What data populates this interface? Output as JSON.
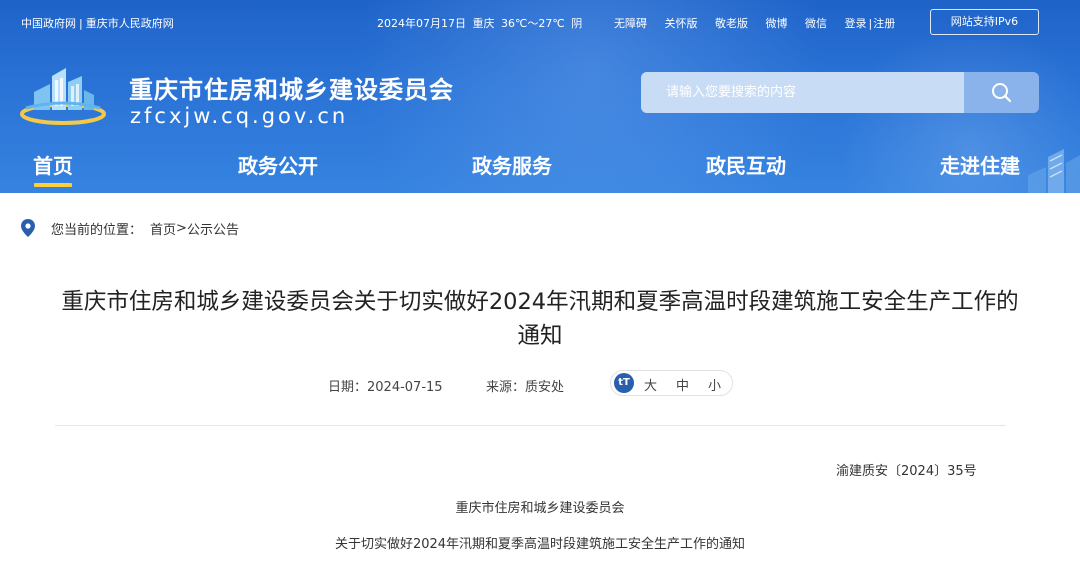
{
  "topbar": {
    "gov_links": [
      "中国政府网",
      "重庆市人民政府网"
    ],
    "separator": "|",
    "date": "2024年07月17日",
    "city": "重庆",
    "temperature": "36℃～27℃",
    "weather": "阴",
    "links": [
      "无障碍",
      "关怀版",
      "敬老版",
      "微博",
      "微信",
      "登录"
    ],
    "register": "注册",
    "ipv6": "网站支持IPv6"
  },
  "brand": {
    "title": "重庆市住房和城乡建设委员会",
    "domain": "zfcxjw.cq.gov.cn",
    "logo_icon": "building-emblem-icon"
  },
  "search": {
    "placeholder": "请输入您要搜索的内容",
    "icon": "search-icon"
  },
  "nav": {
    "items": [
      "首页",
      "政务公开",
      "政务服务",
      "政民互动",
      "走进住建"
    ],
    "active_index": 0
  },
  "breadcrumb": {
    "label": "您当前的位置：",
    "home": "首页",
    "arrow": ">",
    "current": "公示公告"
  },
  "article": {
    "title": "重庆市住房和城乡建设委员会关于切实做好2024年汛期和夏季高温时段建筑施工安全生产工作的通知",
    "date_label": "日期：",
    "date": "2024-07-15",
    "source_label": "来源：",
    "source": "质安处",
    "font_icon": "tT",
    "font_sizes": [
      "大",
      "中",
      "小"
    ],
    "doc_number": "渝建质安〔2024〕35号",
    "issuer": "重庆市住房和城乡建设委员会",
    "subject": "关于切实做好2024年汛期和夏季高温时段建筑施工安全生产工作的通知"
  },
  "colors": {
    "header_bg": "#2a73d6",
    "nav_active_underline": "#ffcf3a",
    "font_badge": "#2a5fae"
  }
}
